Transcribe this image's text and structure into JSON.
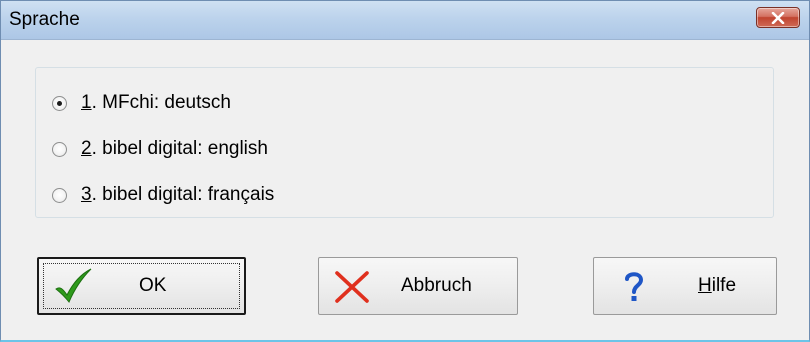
{
  "window": {
    "title": "Sprache",
    "close_icon": "close-icon"
  },
  "language_options": [
    {
      "number": "1",
      "suffix": ". MFchi: deutsch",
      "checked": true
    },
    {
      "number": "2",
      "suffix": ". bibel digital: english",
      "checked": false
    },
    {
      "number": "3",
      "suffix": ". bibel digital: français",
      "checked": false
    }
  ],
  "buttons": {
    "ok": {
      "label": "OK",
      "icon": "checkmark-icon",
      "icon_color": "#2e9a1c"
    },
    "abbruch": {
      "label": "Abbruch",
      "icon": "cross-icon",
      "icon_color": "#e0301e"
    },
    "hilfe": {
      "mnemonic": "H",
      "rest": "ilfe",
      "icon": "question-mark-icon",
      "icon_color": "#1f56c6"
    }
  }
}
